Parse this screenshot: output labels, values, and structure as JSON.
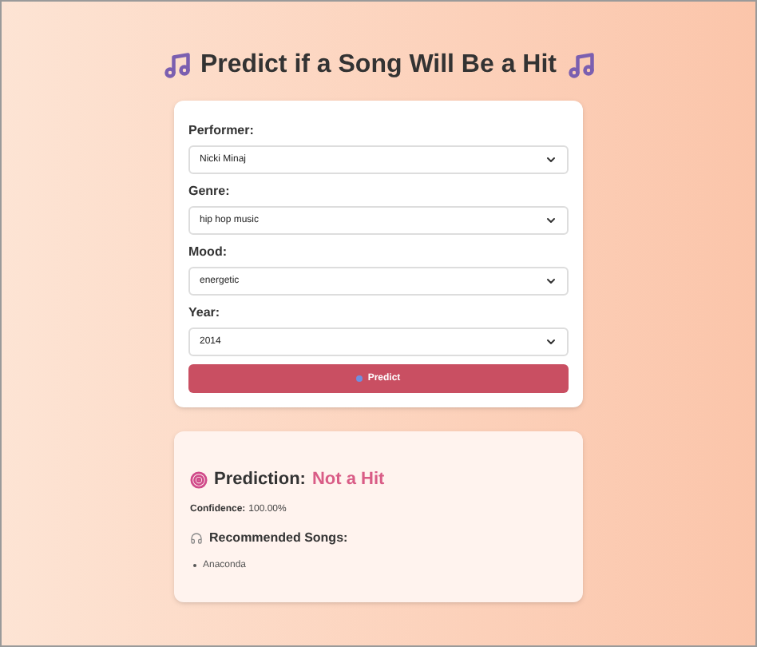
{
  "title": "Predict if a Song Will Be a Hit",
  "fields": [
    {
      "label": "Performer:",
      "value": "Nicki Minaj"
    },
    {
      "label": "Genre:",
      "value": "hip hop music"
    },
    {
      "label": "Mood:",
      "value": "energetic"
    },
    {
      "label": "Year:",
      "value": "2014"
    }
  ],
  "predict_button": "Predict",
  "result": {
    "heading": "Prediction:",
    "verdict": "Not a Hit",
    "confidence_label": "Confidence:",
    "confidence": "100.00%",
    "recommended_heading": "Recommended Songs:",
    "songs": [
      "Anaconda"
    ]
  }
}
